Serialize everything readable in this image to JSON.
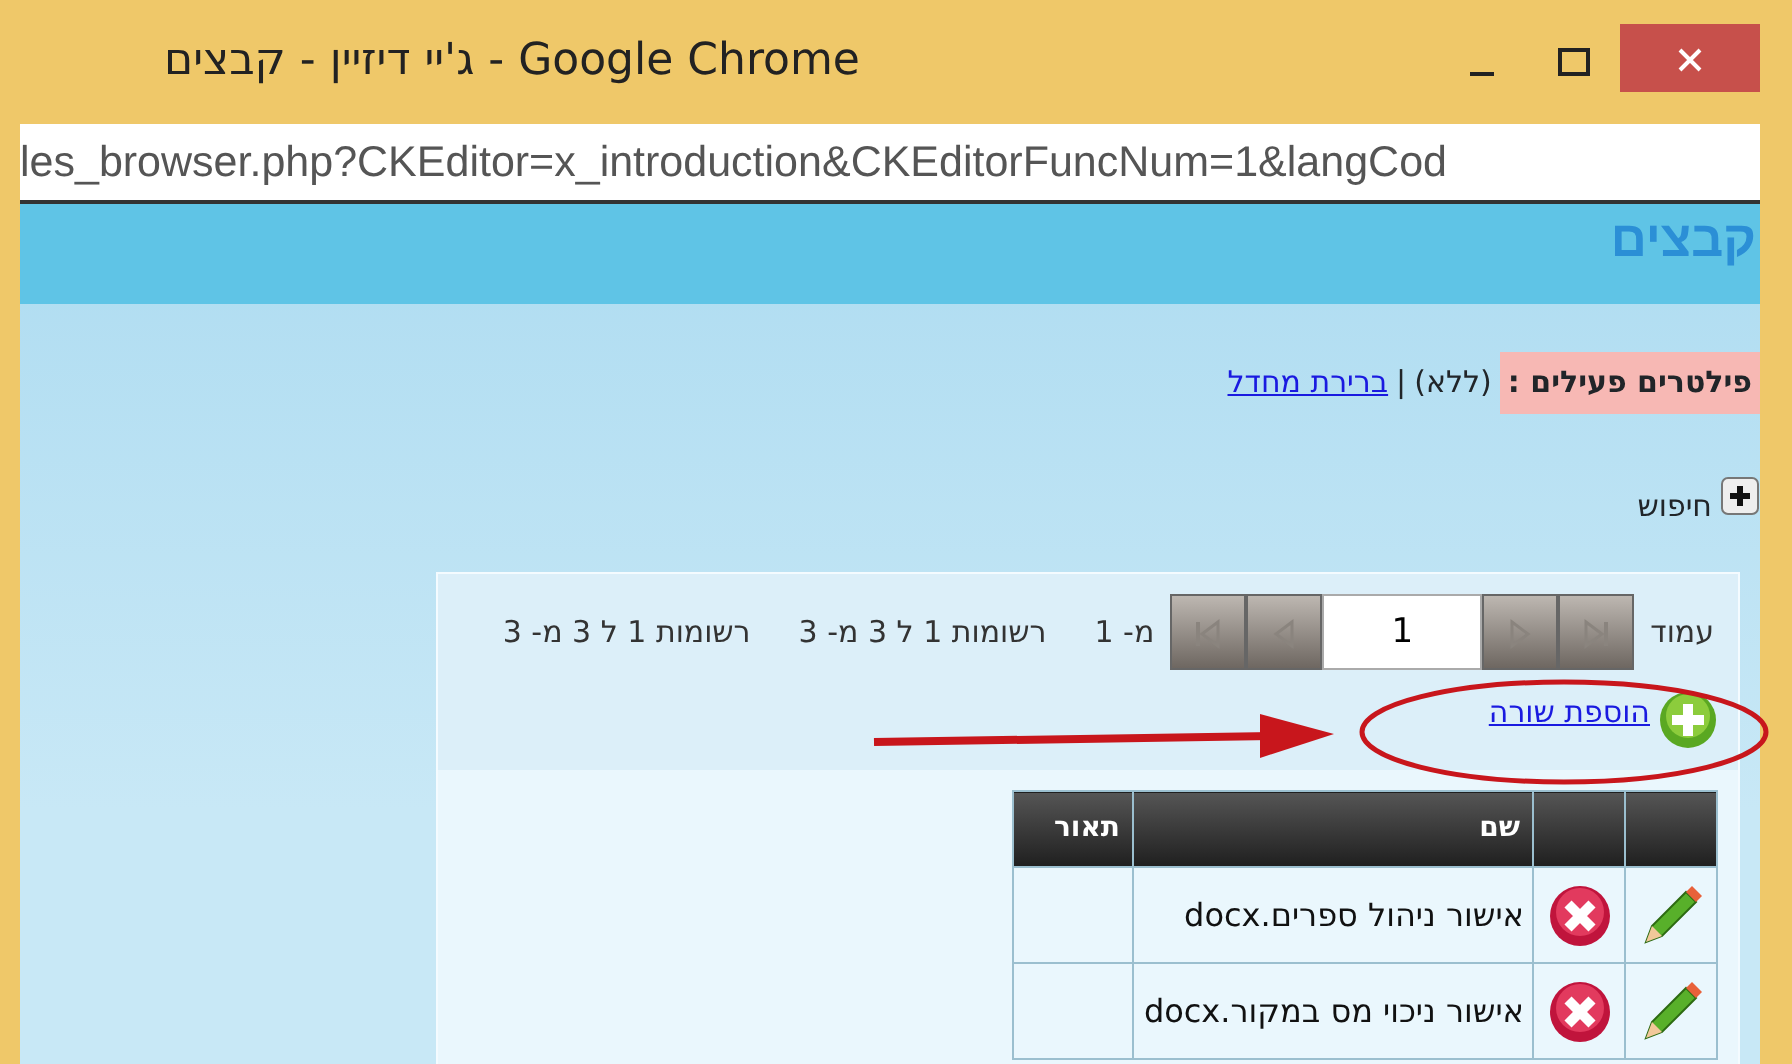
{
  "window": {
    "title": "ג'יי דיזיין - קבצים - Google Chrome",
    "url": "les_browser.php?CKEditor=x_introduction&CKEditorFuncNum=1&langCod"
  },
  "page": {
    "heading": "קבצים",
    "filters": {
      "label": "פילטרים פעילים :",
      "value": "(ללא)",
      "separator": "|",
      "link": "ברירת מחדל"
    },
    "search": {
      "label": "חיפוש"
    },
    "pager": {
      "label": "עמוד",
      "page": "1",
      "of_pages": "מ- 1",
      "records": [
        "רשומות 1 ל 3 מ- 3",
        "רשומות 1 ל 3 מ- 3"
      ]
    },
    "add_row": "הוספת שורה",
    "table": {
      "columns": [
        "שם",
        "תאור"
      ],
      "rows": [
        {
          "name": "אישור ניהול ספרים.docx"
        },
        {
          "name": "אישור ניכוי מס במקור.docx"
        }
      ]
    }
  }
}
